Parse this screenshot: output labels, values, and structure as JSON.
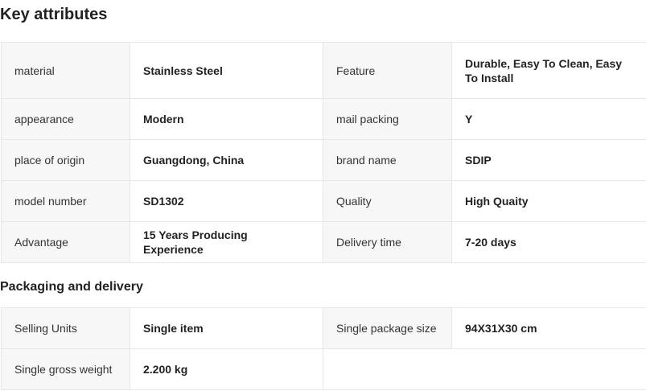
{
  "key_attributes": {
    "title": "Key attributes",
    "rows": [
      [
        {
          "label": "material",
          "value": "Stainless Steel"
        },
        {
          "label": "Feature",
          "value": "Durable, Easy To Clean, Easy To Install"
        }
      ],
      [
        {
          "label": "appearance",
          "value": "Modern"
        },
        {
          "label": "mail packing",
          "value": "Y"
        }
      ],
      [
        {
          "label": "place of origin",
          "value": "Guangdong, China"
        },
        {
          "label": "brand name",
          "value": "SDIP"
        }
      ],
      [
        {
          "label": "model number",
          "value": "SD1302"
        },
        {
          "label": "Quality",
          "value": "High Quaity"
        }
      ],
      [
        {
          "label": "Advantage",
          "value": "15 Years Producing Experience"
        },
        {
          "label": "Delivery time",
          "value": "7-20 days"
        }
      ]
    ]
  },
  "packaging_delivery": {
    "title": "Packaging and delivery",
    "rows": [
      [
        {
          "label": "Selling Units",
          "value": "Single item"
        },
        {
          "label": "Single package size",
          "value": "94X31X30 cm"
        }
      ],
      [
        {
          "label": "Single gross weight",
          "value": "2.200 kg"
        }
      ]
    ]
  }
}
